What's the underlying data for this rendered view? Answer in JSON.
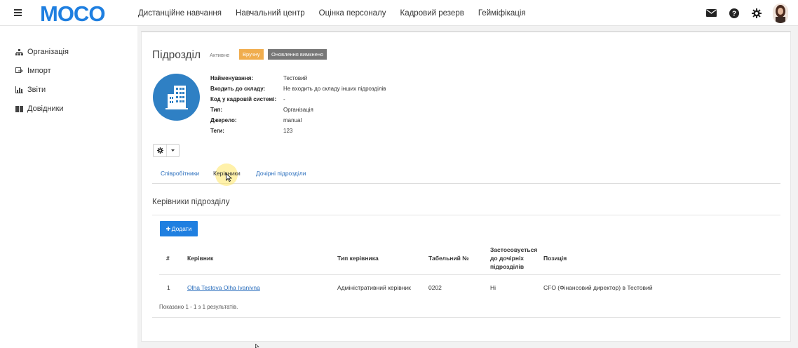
{
  "header": {
    "logo_text": "MOCO",
    "nav": [
      "Дистанційне навчання",
      "Навчальний центр",
      "Оцінка персоналу",
      "Кадровий резерв",
      "Гейміфікація"
    ],
    "icons": [
      "envelope-icon",
      "question-icon",
      "gear-icon",
      "avatar"
    ]
  },
  "sidebar": {
    "items": [
      {
        "label": "Організація",
        "icon": "org-chart-icon"
      },
      {
        "label": "Імпорт",
        "icon": "import-icon"
      },
      {
        "label": "Звіти",
        "icon": "bar-chart-icon"
      },
      {
        "label": "Довідники",
        "icon": "book-icon"
      }
    ]
  },
  "unit": {
    "title": "Підрозділ",
    "status": "Активне",
    "badge_manual": "Вручну",
    "badge_updates": "Оновлення вимкнено",
    "props": [
      {
        "key": "Найменування:",
        "value": "Тестовий"
      },
      {
        "key": "Входить до складу:",
        "value": "Не входить до складу інших підрозділів"
      },
      {
        "key": "Код у кадровій системі:",
        "value": "-"
      },
      {
        "key": "Тип:",
        "value": "Організація"
      },
      {
        "key": "Джерело:",
        "value": "manual"
      },
      {
        "key": "Теги:",
        "value": "123"
      }
    ]
  },
  "tabs": [
    {
      "label": "Співробітники"
    },
    {
      "label": "Керівники",
      "active": true
    },
    {
      "label": "Дочірні підрозділи"
    }
  ],
  "managers": {
    "section_title": "Керівники підрозділу",
    "add_label": "Додати",
    "columns": {
      "num": "#",
      "manager": "Керівник",
      "type": "Тип керівника",
      "tabnum": "Табельний №",
      "applies_l1": "Застосовується",
      "applies_l2": "до дочірніх",
      "applies_l3": "підрозділів",
      "position": "Позиція"
    },
    "rows": [
      {
        "num": "1",
        "manager": "Olha Testova Olha Ivanivna",
        "type": "Адміністративний керівник",
        "tabnum": "0202",
        "applies": "Ні",
        "position": "CFO (Фінансовий директор) в Тестовий"
      }
    ],
    "summary": "Показано 1 - 1 з 1 результатів."
  },
  "colors": {
    "brand": "#1f7fe0",
    "link": "#2a6ebd",
    "badge_orange": "#f0ad4e",
    "badge_gray": "#777777",
    "unit_icon_bg": "#2f80c4"
  }
}
